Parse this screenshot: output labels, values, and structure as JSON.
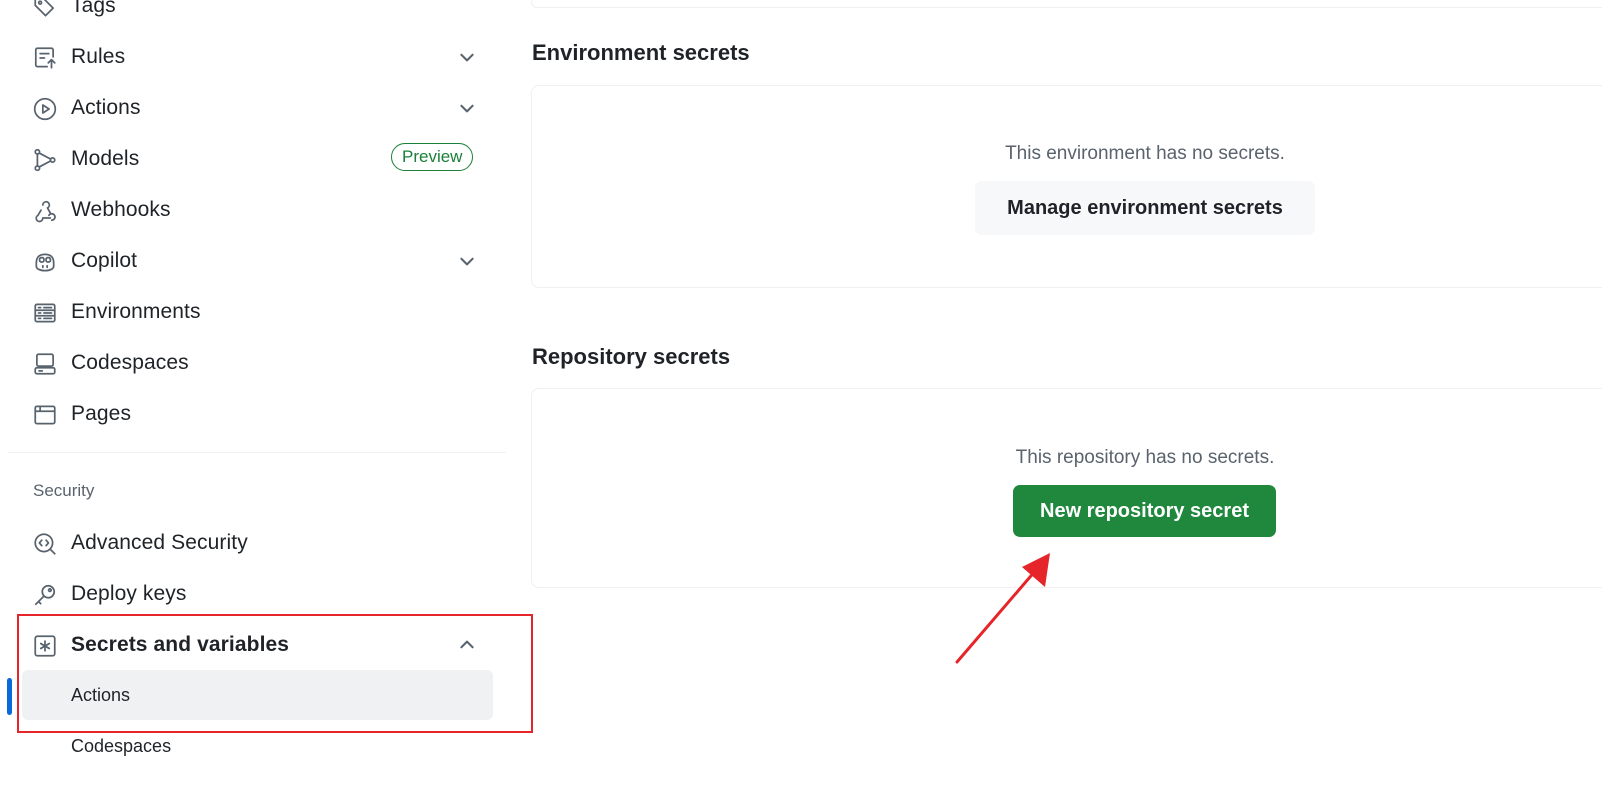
{
  "sidebar": {
    "items": [
      {
        "label": "Tags",
        "icon": "tag-icon"
      },
      {
        "label": "Rules",
        "icon": "rules-icon",
        "chevron": "chevron-down-icon"
      },
      {
        "label": "Actions",
        "icon": "play-icon",
        "chevron": "chevron-down-icon"
      },
      {
        "label": "Models",
        "icon": "models-icon",
        "badge": "Preview"
      },
      {
        "label": "Webhooks",
        "icon": "webhook-icon"
      },
      {
        "label": "Copilot",
        "icon": "copilot-icon",
        "chevron": "chevron-down-icon"
      },
      {
        "label": "Environments",
        "icon": "server-icon"
      },
      {
        "label": "Codespaces",
        "icon": "codespaces-icon"
      },
      {
        "label": "Pages",
        "icon": "browser-icon"
      }
    ],
    "security_section": {
      "title": "Security",
      "items": [
        {
          "label": "Advanced Security",
          "icon": "codescan-icon"
        },
        {
          "label": "Deploy keys",
          "icon": "key-icon"
        },
        {
          "label": "Secrets and variables",
          "icon": "asterisk-icon",
          "chevron": "chevron-up-icon",
          "expanded": true,
          "children": [
            {
              "label": "Actions",
              "active": true
            },
            {
              "label": "Codespaces",
              "active": false
            }
          ]
        }
      ]
    }
  },
  "main": {
    "environment_secrets": {
      "heading": "Environment secrets",
      "empty_text": "This environment has no secrets.",
      "button_label": "Manage environment secrets"
    },
    "repository_secrets": {
      "heading": "Repository secrets",
      "empty_text": "This repository has no secrets.",
      "button_label": "New repository secret"
    }
  },
  "colors": {
    "accent_green": "#1f883d",
    "annotation_red": "#e5252a",
    "active_indicator": "#0969da",
    "badge_green": "#1a7f37"
  }
}
